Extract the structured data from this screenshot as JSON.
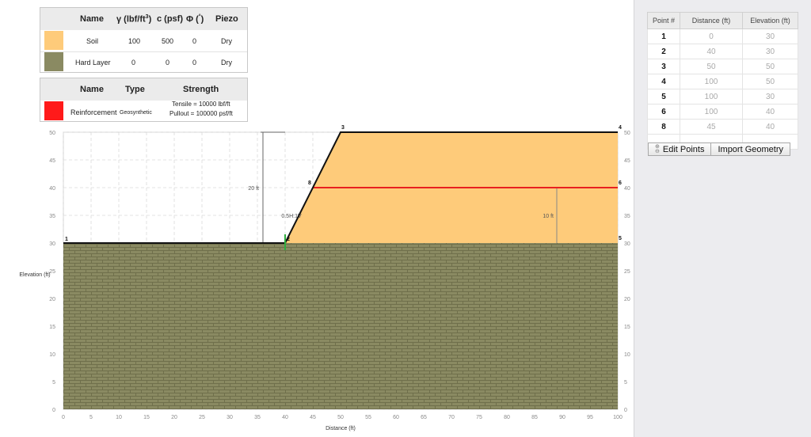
{
  "materials": {
    "headers": {
      "name": "Name",
      "gamma": "γ (lbf/ft",
      "gamma_sup": "3",
      "gamma_close": ")",
      "c": "c (psf)",
      "phi": "Φ (",
      "phi_sup": "°",
      "phi_close": ")",
      "piezo": "Piezo"
    },
    "rows": [
      {
        "name": "Soil",
        "gamma": "100",
        "c": "500",
        "phi": "0",
        "piezo": "Dry",
        "color": "#fecb7a"
      },
      {
        "name": "Hard Layer",
        "gamma": "0",
        "c": "0",
        "phi": "0",
        "piezo": "Dry",
        "color": "#8a8a62"
      }
    ]
  },
  "reinforcement": {
    "headers": {
      "name": "Name",
      "type": "Type",
      "strength": "Strength"
    },
    "rows": [
      {
        "name": "Reinforcement",
        "type": "Geosynthetic",
        "tensile": "Tensile = 10000 lbf/ft",
        "pullout": "Pullout = 100000 psf/ft",
        "color": "#ff1a1a"
      }
    ]
  },
  "points_table": {
    "headers": [
      "Point #",
      "Distance (ft)",
      "Elevation (ft)"
    ],
    "rows": [
      [
        "1",
        "0",
        "30"
      ],
      [
        "2",
        "40",
        "30"
      ],
      [
        "3",
        "50",
        "50"
      ],
      [
        "4",
        "100",
        "50"
      ],
      [
        "5",
        "100",
        "30"
      ],
      [
        "6",
        "100",
        "40"
      ],
      [
        "8",
        "45",
        "40"
      ]
    ]
  },
  "buttons": {
    "edit_points": "Edit Points",
    "import_geometry": "Import Geometry",
    "edit_icon": "zoom-icon"
  },
  "chart_data": {
    "type": "cross-section",
    "xlabel": "Distance (ft)",
    "ylabel": "Elevation (ft)",
    "xlim": [
      0,
      100
    ],
    "ylim": [
      0,
      50
    ],
    "xticks": [
      0,
      5,
      10,
      15,
      20,
      25,
      30,
      35,
      40,
      45,
      50,
      55,
      60,
      65,
      70,
      75,
      80,
      85,
      90,
      95,
      100
    ],
    "yticks": [
      0,
      5,
      10,
      15,
      20,
      25,
      30,
      35,
      40,
      45,
      50
    ],
    "points": [
      {
        "id": "1",
        "x": 0,
        "y": 30
      },
      {
        "id": "2",
        "x": 40,
        "y": 30
      },
      {
        "id": "3",
        "x": 50,
        "y": 50
      },
      {
        "id": "4",
        "x": 100,
        "y": 50
      },
      {
        "id": "5",
        "x": 100,
        "y": 30
      },
      {
        "id": "6",
        "x": 100,
        "y": 40
      },
      {
        "id": "8",
        "x": 45,
        "y": 40
      }
    ],
    "soil_polygon": [
      [
        40,
        30
      ],
      [
        50,
        50
      ],
      [
        100,
        50
      ],
      [
        100,
        30
      ]
    ],
    "hard_layer": {
      "from": [
        0,
        0
      ],
      "to": [
        100,
        30
      ]
    },
    "reinforcement": {
      "from": [
        45,
        40
      ],
      "to": [
        100,
        40
      ],
      "color": "#e82020"
    },
    "annotations": [
      {
        "text": "20 ft",
        "x": 36,
        "y1": 30,
        "y2": 50
      },
      {
        "text": "10 ft",
        "x": 89,
        "y1": 30,
        "y2": 40
      },
      {
        "text": "0.5H:1V",
        "x": 41,
        "y": 35
      }
    ],
    "colors": {
      "soil": "#fecb7a",
      "hard": "#8a8a62",
      "brick_line": "#6f6f4b",
      "outline": "#111111"
    }
  }
}
